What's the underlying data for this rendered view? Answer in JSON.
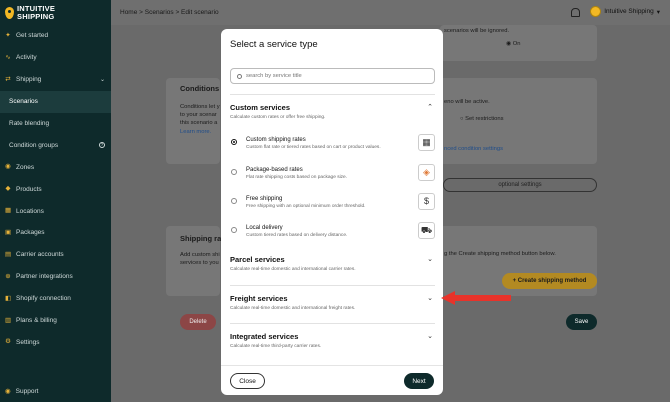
{
  "brand": {
    "line1": "INTUITIVE",
    "line2": "SHIPPING"
  },
  "sidebar": {
    "items": [
      {
        "label": "Get started",
        "icon": "rocket-icon",
        "glyph": "✦"
      },
      {
        "label": "Activity",
        "icon": "activity-icon",
        "glyph": "∿"
      },
      {
        "label": "Shipping",
        "icon": "shipping-icon",
        "glyph": "⇄"
      },
      {
        "label": "Scenarios",
        "icon": "",
        "glyph": ""
      },
      {
        "label": "Rate blending",
        "icon": "",
        "glyph": ""
      },
      {
        "label": "Condition groups",
        "icon": "",
        "glyph": ""
      },
      {
        "label": "Zones",
        "icon": "globe-icon",
        "glyph": "◉"
      },
      {
        "label": "Products",
        "icon": "tag-icon",
        "glyph": "◆"
      },
      {
        "label": "Locations",
        "icon": "location-icon",
        "glyph": "▦"
      },
      {
        "label": "Packages",
        "icon": "package-icon",
        "glyph": "▣"
      },
      {
        "label": "Carrier accounts",
        "icon": "carrier-icon",
        "glyph": "▤"
      },
      {
        "label": "Partner integrations",
        "icon": "link-icon",
        "glyph": "⊕"
      },
      {
        "label": "Shopify connection",
        "icon": "shopify-icon",
        "glyph": "◧"
      },
      {
        "label": "Plans & billing",
        "icon": "billing-icon",
        "glyph": "▥"
      },
      {
        "label": "Settings",
        "icon": "gear-icon",
        "glyph": "⚙"
      }
    ],
    "support": "Support"
  },
  "breadcrumb": "Home > Scenarios > Edit scenario",
  "user": {
    "name": "Intuitive Shipping"
  },
  "background": {
    "ignored_text": "scenarios will be ignored.",
    "on_label": "On",
    "conditions_title": "Conditions",
    "conditions_desc": [
      "Conditions let y",
      "to your scenar",
      "this scenario a"
    ],
    "learn_more": "Learn more.",
    "will_be_active": "eno will be active.",
    "set_restrictions": "Set restrictions",
    "advanced_link": "nced condition settings",
    "optional_settings": "optional settings",
    "shipping_rates_title": "Shipping rat",
    "shipping_rates_desc": [
      "Add custom shi",
      "services to you"
    ],
    "create_hint": "g the Create shipping method button below.",
    "create_button": "+ Create shipping method",
    "delete_button": "Delete",
    "save_button": "Save"
  },
  "modal": {
    "title": "Select a service type",
    "search_placeholder": "search by service title",
    "sections": [
      {
        "title": "Custom services",
        "desc": "Calculate custom rates or offer free shipping."
      },
      {
        "title": "Parcel services",
        "desc": "Calculate real-time domestic and international carrier rates."
      },
      {
        "title": "Freight services",
        "desc": "Calculate real-time domestic and international freight rates."
      },
      {
        "title": "Integrated services",
        "desc": "Calculate real-time third-party carrier rates."
      }
    ],
    "options": [
      {
        "title": "Custom shipping rates",
        "desc": "Custom flat rate or tiered rates based on cart or product values.",
        "icon": "table-icon",
        "glyph": "▦",
        "selected": true
      },
      {
        "title": "Package-based rates",
        "desc": "Flat rate shipping costs based on package size.",
        "icon": "box-icon",
        "glyph": "◈",
        "selected": false
      },
      {
        "title": "Free shipping",
        "desc": "Free shipping with an optional minimum order threshold.",
        "icon": "dollar-icon",
        "glyph": "$",
        "selected": false
      },
      {
        "title": "Local delivery",
        "desc": "Custom tiered rates based on delivery distance.",
        "icon": "truck-icon",
        "glyph": "⛟",
        "selected": false
      }
    ],
    "close_label": "Close",
    "next_label": "Next"
  },
  "colors": {
    "accent": "#f2b824",
    "sidebar": "#0e2a2b",
    "arrow": "#e8332a",
    "delete": "#e06a6a"
  }
}
